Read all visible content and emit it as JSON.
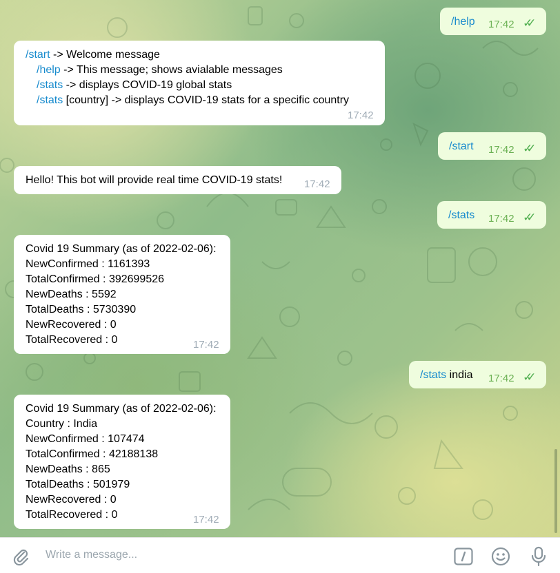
{
  "messages": {
    "help_cmd": {
      "text": "/help",
      "time": "17:42"
    },
    "help_reply": {
      "lines": [
        {
          "cmd": "/start",
          "rest": " -> Welcome message"
        },
        {
          "cmd": "/help",
          "rest": " -> This message; shows avialable messages"
        },
        {
          "cmd": "/stats",
          "rest": " -> displays COVID-19 global stats"
        },
        {
          "cmd": "/stats",
          "rest": " [country] -> displays COVID-19 stats for a specific country"
        }
      ],
      "time": "17:42"
    },
    "start_cmd": {
      "text": "/start",
      "time": "17:42"
    },
    "start_reply": {
      "text": "Hello! This bot will provide real time COVID-19 stats!",
      "time": "17:42"
    },
    "stats_cmd": {
      "text": "/stats",
      "time": "17:42"
    },
    "stats_reply": {
      "lines": [
        "Covid 19 Summary (as of 2022-02-06):",
        "NewConfirmed : 1161393",
        "TotalConfirmed : 392699526",
        "NewDeaths : 5592",
        "TotalDeaths : 5730390",
        "NewRecovered : 0",
        "TotalRecovered : 0"
      ],
      "time": "17:42"
    },
    "stats_india_cmd": {
      "cmd": "/stats",
      "arg": " india",
      "time": "17:42"
    },
    "stats_india_reply": {
      "lines": [
        "Covid 19 Summary (as of 2022-02-06):",
        "Country : India",
        "NewConfirmed : 107474",
        "TotalConfirmed : 42188138",
        "NewDeaths : 865",
        "TotalDeaths : 501979",
        "NewRecovered : 0",
        "TotalRecovered : 0"
      ],
      "time": "17:42"
    }
  },
  "composer": {
    "placeholder": "Write a message...",
    "icons": [
      "paperclip-icon",
      "bot-commands-icon",
      "emoji-icon",
      "microphone-icon"
    ]
  },
  "colors": {
    "command_link": "#168acd",
    "outgoing_bubble": "#effdde",
    "read_ticks": "#4fae4e"
  }
}
